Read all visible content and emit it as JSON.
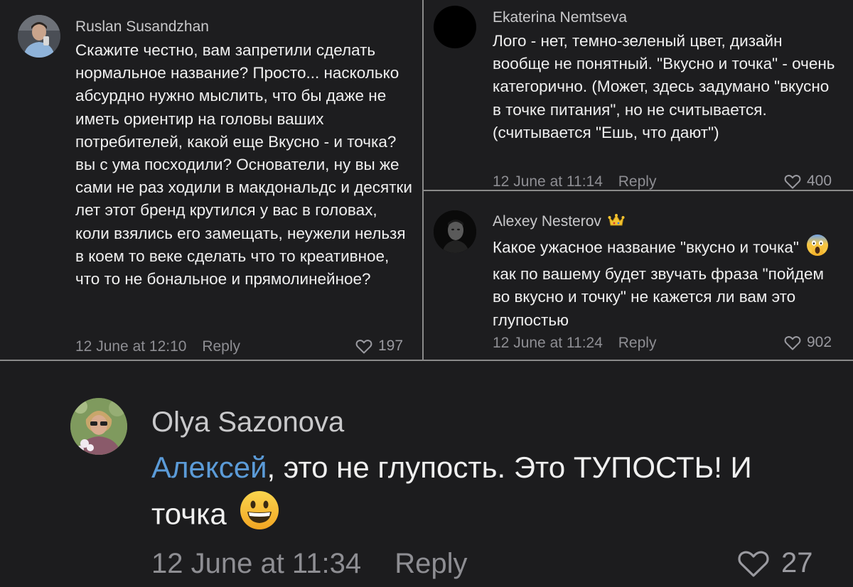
{
  "comments": [
    {
      "author": "Ruslan Susandzhan",
      "text": "Скажите честно, вам запретили сделать нормальное название? Просто... насколько абсурдно нужно мыслить, что бы даже не иметь ориентир на головы ваших потребителей, какой еще Вкусно - и точка? вы с ума посходили? Основатели, ну вы же сами не раз ходили в макдональдс и десятки лет этот бренд крутился у вас в головах, коли взялись его замещать, неужели нельзя в коем то веке сделать что то креативное, что то не бональное и прямолинейное?",
      "time": "12 June at 12:10",
      "reply": "Reply",
      "likes": "197"
    },
    {
      "author": "Ekaterina Nemtseva",
      "text": "Лого - нет, темно-зеленый цвет, дизайн вообще не понятный. \"Вкусно и точка\" - очень категорично. (Может, здесь задумано \"вкусно в точке питания\", но не считывается. (считывается \"Ешь, что дают\")",
      "time": "12 June at 11:14",
      "reply": "Reply",
      "likes": "400"
    },
    {
      "author": "Alexey Nesterov",
      "badge_icon": "crown-emoji",
      "text_part1": "Какое ужасное название \"вкусно и точка\"",
      "emoji": "scream-emoji",
      "text_part2": "как по вашему будет звучать фраза \"пойдем во вкусно и точку\" не кажется ли вам это глупостью",
      "time": "12 June at 11:24",
      "reply": "Reply",
      "likes": "902"
    },
    {
      "author": "Olya Sazonova",
      "mention": "Алексей",
      "text": ", это не глупость. Это ТУПОСТЬ! И точка",
      "emoji": "grinning-emoji",
      "time": "12 June at 11:34",
      "reply": "Reply",
      "likes": "27"
    }
  ],
  "colors": {
    "background": "#1d1d1f",
    "text": "#f0f0f0",
    "muted": "#8e8e93",
    "mention": "#5b9bd8",
    "divider": "#8a8a8a"
  }
}
